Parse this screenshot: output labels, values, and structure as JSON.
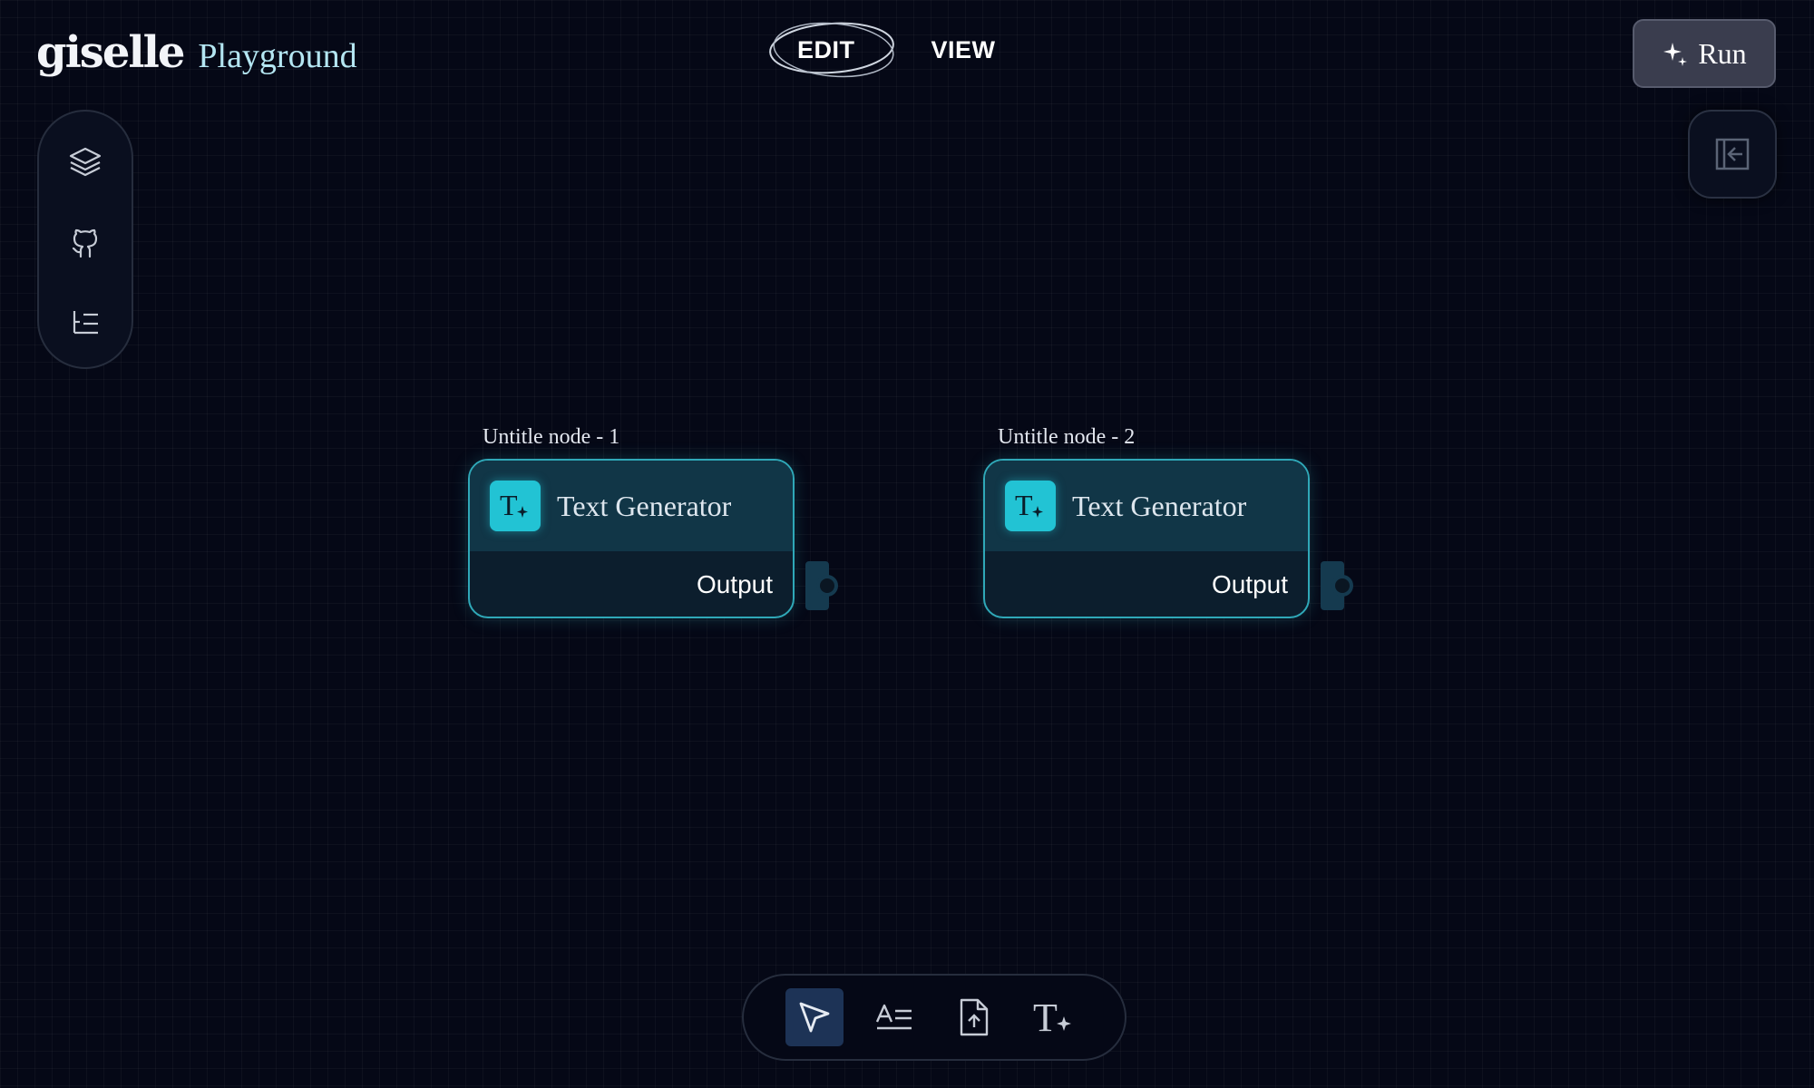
{
  "header": {
    "logo_text": "giselle",
    "logo_sub": "Playground",
    "modes": [
      {
        "label": "EDIT",
        "active": true
      },
      {
        "label": "VIEW",
        "active": false
      }
    ],
    "run_label": "Run"
  },
  "left_toolbar": {
    "items": [
      {
        "icon": "layers-icon"
      },
      {
        "icon": "github-icon"
      },
      {
        "icon": "list-tree-icon"
      }
    ]
  },
  "right_panel": {
    "toggle_icon": "collapse-left-icon"
  },
  "nodes": [
    {
      "title": "Untitle node - 1",
      "label": "Text Generator",
      "output": "Output",
      "icon": "text-generator-icon"
    },
    {
      "title": "Untitle node - 2",
      "label": "Text Generator",
      "output": "Output",
      "icon": "text-generator-icon"
    }
  ],
  "bottom_toolbar": {
    "tools": [
      {
        "icon": "pointer-icon",
        "active": true
      },
      {
        "icon": "text-input-icon",
        "active": false
      },
      {
        "icon": "file-upload-icon",
        "active": false
      },
      {
        "icon": "text-generator-icon",
        "active": false
      }
    ]
  },
  "colors": {
    "background": "#050816",
    "node_border": "#2fa8b8",
    "node_header": "#113647",
    "node_icon": "#22c3d4",
    "run_button": "#3a3d4e",
    "active_tool": "#1d3356"
  }
}
